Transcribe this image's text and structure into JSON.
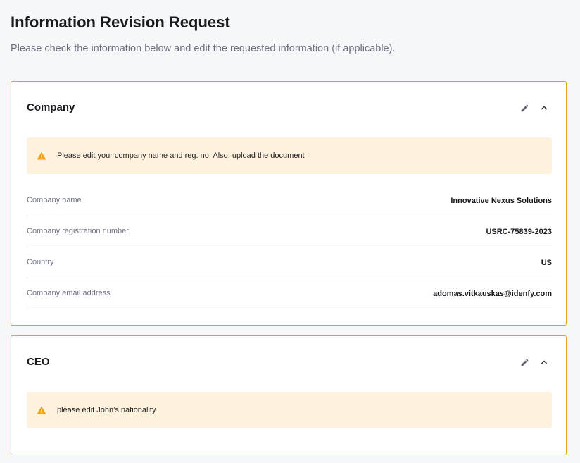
{
  "page": {
    "title": "Information Revision Request",
    "subtitle": "Please check the information below and edit the requested information (if applicable)."
  },
  "colors": {
    "accent_border": "#e5a21b",
    "alert_background": "#fef2dc",
    "warning_icon": "#f2a10f"
  },
  "company": {
    "title": "Company",
    "edit_icon": "pencil-icon",
    "collapse_icon": "chevron-up-icon",
    "alert_icon": "warning-icon",
    "alert_text": "Please edit your company name and reg. no. Also, upload the document",
    "fields": [
      {
        "label": "Company name",
        "value": "Innovative Nexus Solutions"
      },
      {
        "label": "Company registration number",
        "value": "USRC-75839-2023"
      },
      {
        "label": "Country",
        "value": "US"
      },
      {
        "label": "Company email address",
        "value": "adomas.vitkauskas@idenfy.com"
      }
    ]
  },
  "ceo": {
    "title": "CEO",
    "edit_icon": "pencil-icon",
    "collapse_icon": "chevron-up-icon",
    "alert_icon": "warning-icon",
    "alert_text": "please edit John’s nationality"
  }
}
